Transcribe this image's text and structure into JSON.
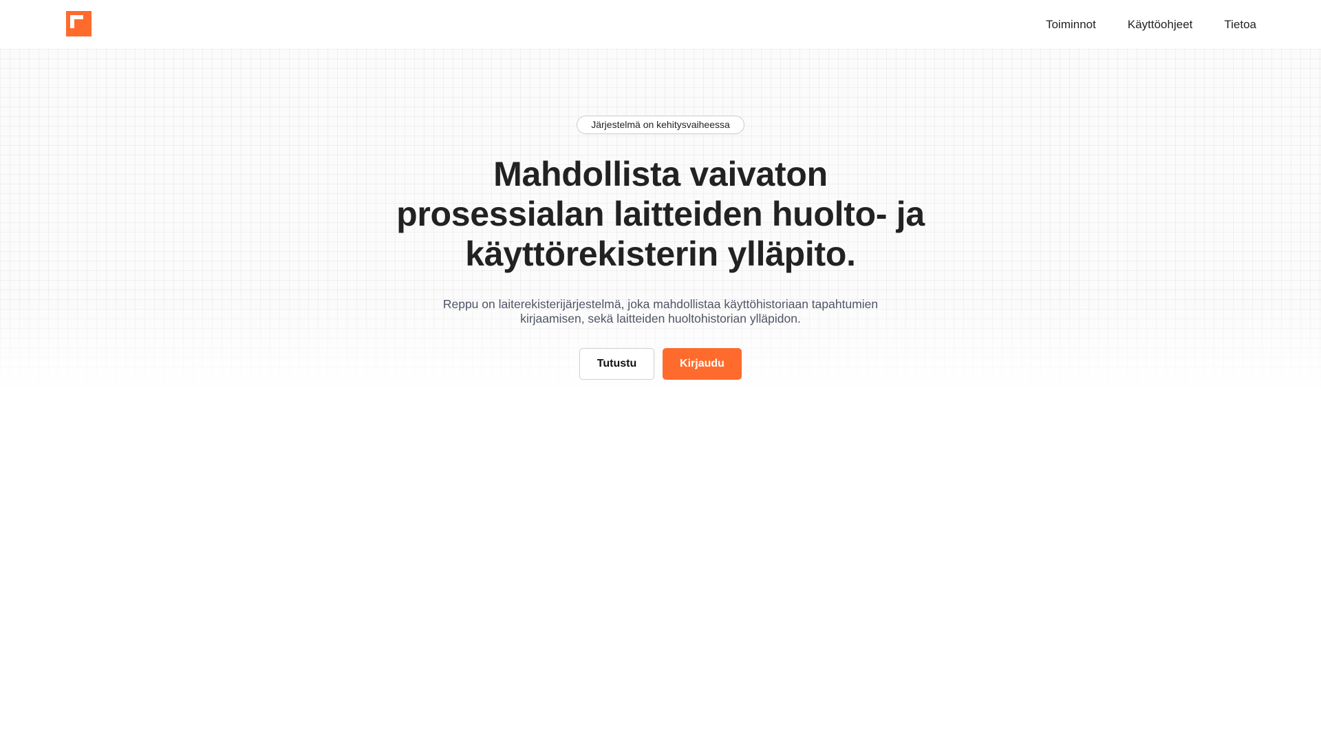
{
  "header": {
    "logo_icon": "orange-square-logo-icon",
    "nav": [
      {
        "label": "Toiminnot"
      },
      {
        "label": "Käyttöohjeet"
      },
      {
        "label": "Tietoa"
      }
    ]
  },
  "hero": {
    "badge": "Järjestelmä on kehitysvaiheessa",
    "title_lines": [
      "Mahdollista vaivaton",
      "prosessialan laitteiden huolto- ja",
      "käyttörekisterin ylläpito."
    ],
    "subtitle": "Reppu on laiterekisterijärjestelmä, joka mahdollistaa käyttöhistoriaan tapahtumien kirjaamisen, sekä laitteiden huoltohistorian ylläpidon.",
    "buttons": {
      "secondary": "Tutustu",
      "primary": "Kirjaudu"
    }
  },
  "colors": {
    "accent": "#ff6b2c",
    "text": "#222222",
    "muted_text": "#4f5565",
    "background": "#ffffff"
  }
}
